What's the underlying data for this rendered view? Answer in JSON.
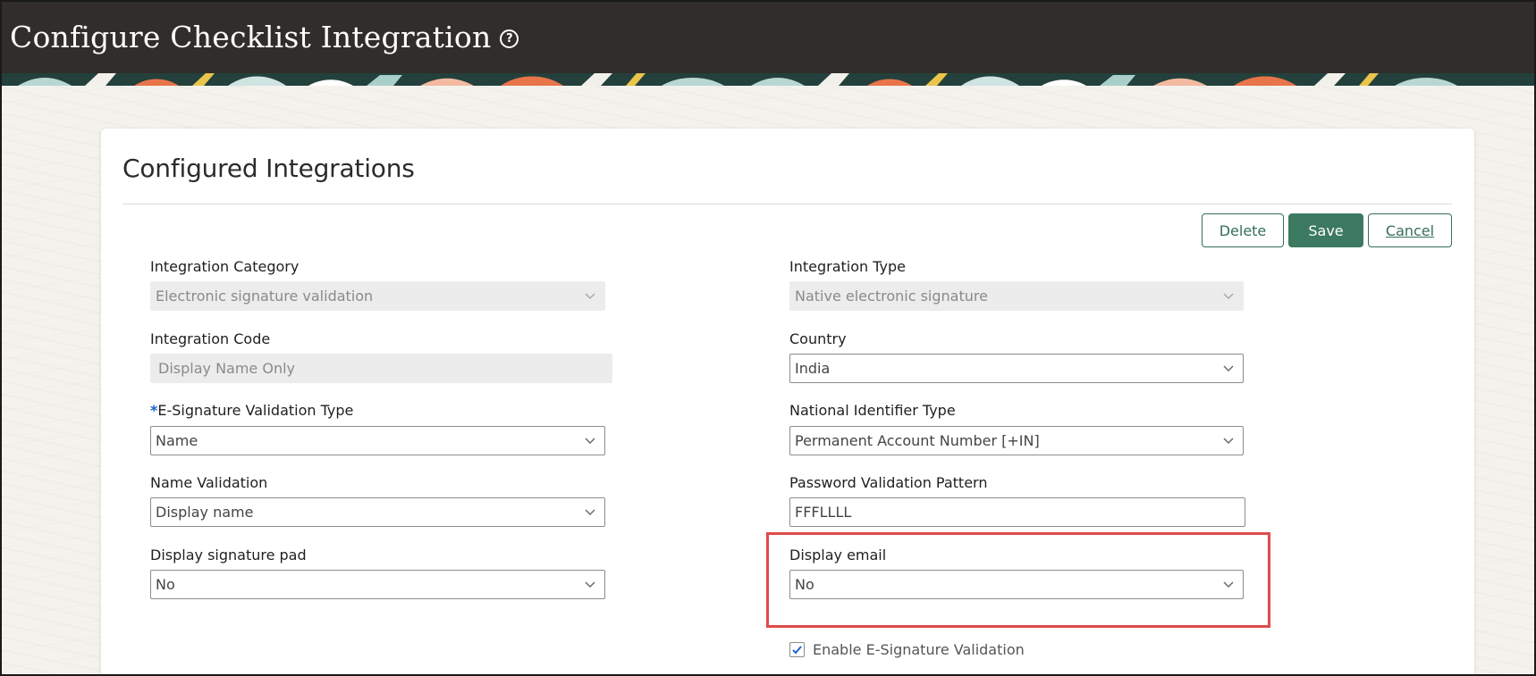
{
  "header": {
    "title": "Configure Checklist Integration",
    "help_icon": "help-circle-icon"
  },
  "section": {
    "title": "Configured Integrations"
  },
  "actions": {
    "delete_label": "Delete",
    "save_label": "Save",
    "cancel_label": "Cancel"
  },
  "colors": {
    "header_bg": "#312d2a",
    "accent": "#3b7a60",
    "highlight": "#e04b4b"
  },
  "fields": {
    "integration_category": {
      "label": "Integration Category",
      "value": "Electronic signature validation",
      "disabled": true
    },
    "integration_type": {
      "label": "Integration Type",
      "value": "Native electronic signature",
      "disabled": true
    },
    "integration_code": {
      "label": "Integration Code",
      "value": "Display Name Only",
      "disabled": true
    },
    "country": {
      "label": "Country",
      "value": "India"
    },
    "esig_validation_type": {
      "required_mark": "*",
      "label": "E-Signature Validation Type",
      "value": "Name"
    },
    "national_identifier_type": {
      "label": "National Identifier Type",
      "value": "Permanent Account Number [+IN]"
    },
    "name_validation": {
      "label": "Name Validation",
      "value": "Display name"
    },
    "password_validation_pattern": {
      "label": "Password Validation Pattern",
      "value": "FFFLLLL"
    },
    "display_signature_pad": {
      "label": "Display signature pad",
      "value": "No"
    },
    "display_email": {
      "label": "Display email",
      "value": "No"
    }
  },
  "enable_esig_validation": {
    "label": "Enable E-Signature Validation",
    "checked": true
  }
}
